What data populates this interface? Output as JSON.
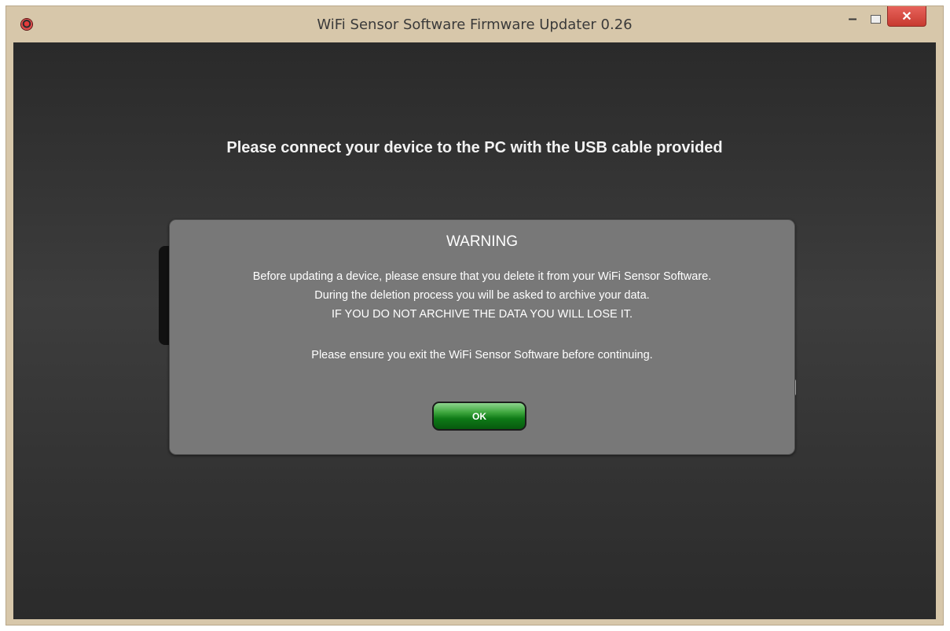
{
  "window": {
    "title": "WiFi Sensor Software Firmware Updater 0.26",
    "minimize_glyph": "–",
    "close_glyph": "✕"
  },
  "main": {
    "instruction": "Please connect your device to the PC with the USB cable provided"
  },
  "dialog": {
    "title": "WARNING",
    "lines": [
      "Before updating a device, please ensure that you delete it from your WiFi Sensor Software.",
      "During the deletion process you will be asked to archive your data.",
      "IF YOU DO NOT ARCHIVE THE DATA YOU WILL LOSE IT.",
      "Please ensure you exit the WiFi Sensor Software before continuing."
    ],
    "ok_label": "OK"
  },
  "colors": {
    "title_bar": "#d7c7aa",
    "close_button": "#d64a40",
    "background": "#333333",
    "dialog": "#787878",
    "ok_button": "#0e7a17"
  },
  "icons": [
    "app-icon",
    "minimize-icon",
    "maximize-icon",
    "close-icon"
  ]
}
